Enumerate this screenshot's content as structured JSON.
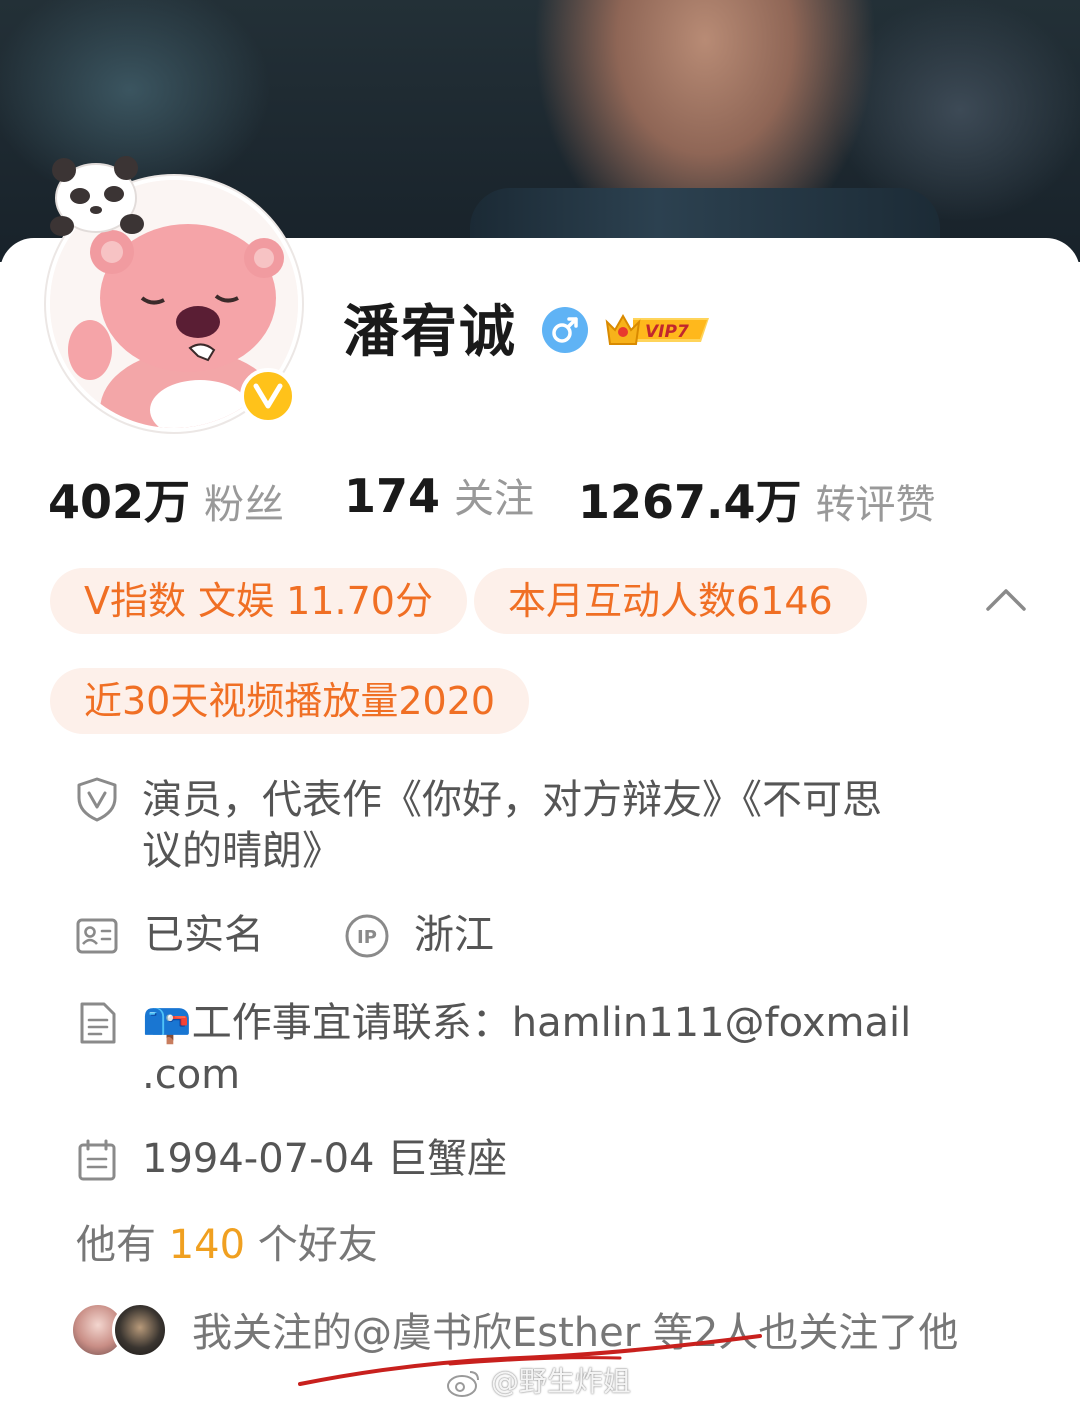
{
  "profile": {
    "name": "潘宥诚",
    "gender": "male",
    "vip_label": "VIP7",
    "verified": "V"
  },
  "stats": [
    {
      "value": "402万",
      "label": "粉丝"
    },
    {
      "value": "174",
      "label": "关注"
    },
    {
      "value": "1267.4万",
      "label": "转评赞"
    }
  ],
  "tags": [
    "V指数 文娱 11.70分",
    "本月互动人数6146",
    "近30天视频播放量2020"
  ],
  "info": {
    "bio_line1": "演员，代表作《你好，对方辩友》《不可思",
    "bio_line2": "议的晴朗》",
    "realname": "已实名",
    "ip_location": "浙江",
    "contact_line1": "📪工作事宜请联系：hamlin111@foxmail",
    "contact_line2": ".com",
    "birthday": "1994-07-04 巨蟹座"
  },
  "friends": {
    "prefix": "他有",
    "count": "140",
    "suffix": "个好友"
  },
  "mutual_follow": {
    "text": "我关注的@虞书欣Esther 等2人也关注了他"
  },
  "watermark": "@野生炸姐",
  "colors": {
    "accent_orange": "#f06f24",
    "tag_background": "#fdf0ea",
    "friends_count": "#f0a020",
    "gender_blue": "#5fb3f5",
    "verified_yellow": "#ffc21a"
  },
  "icons": [
    "gender-male-icon",
    "vip-crown-icon",
    "verified-v-icon",
    "chevron-up-icon",
    "shield-v-icon",
    "id-card-icon",
    "ip-icon",
    "document-icon",
    "calendar-icon",
    "weibo-logo-icon"
  ]
}
